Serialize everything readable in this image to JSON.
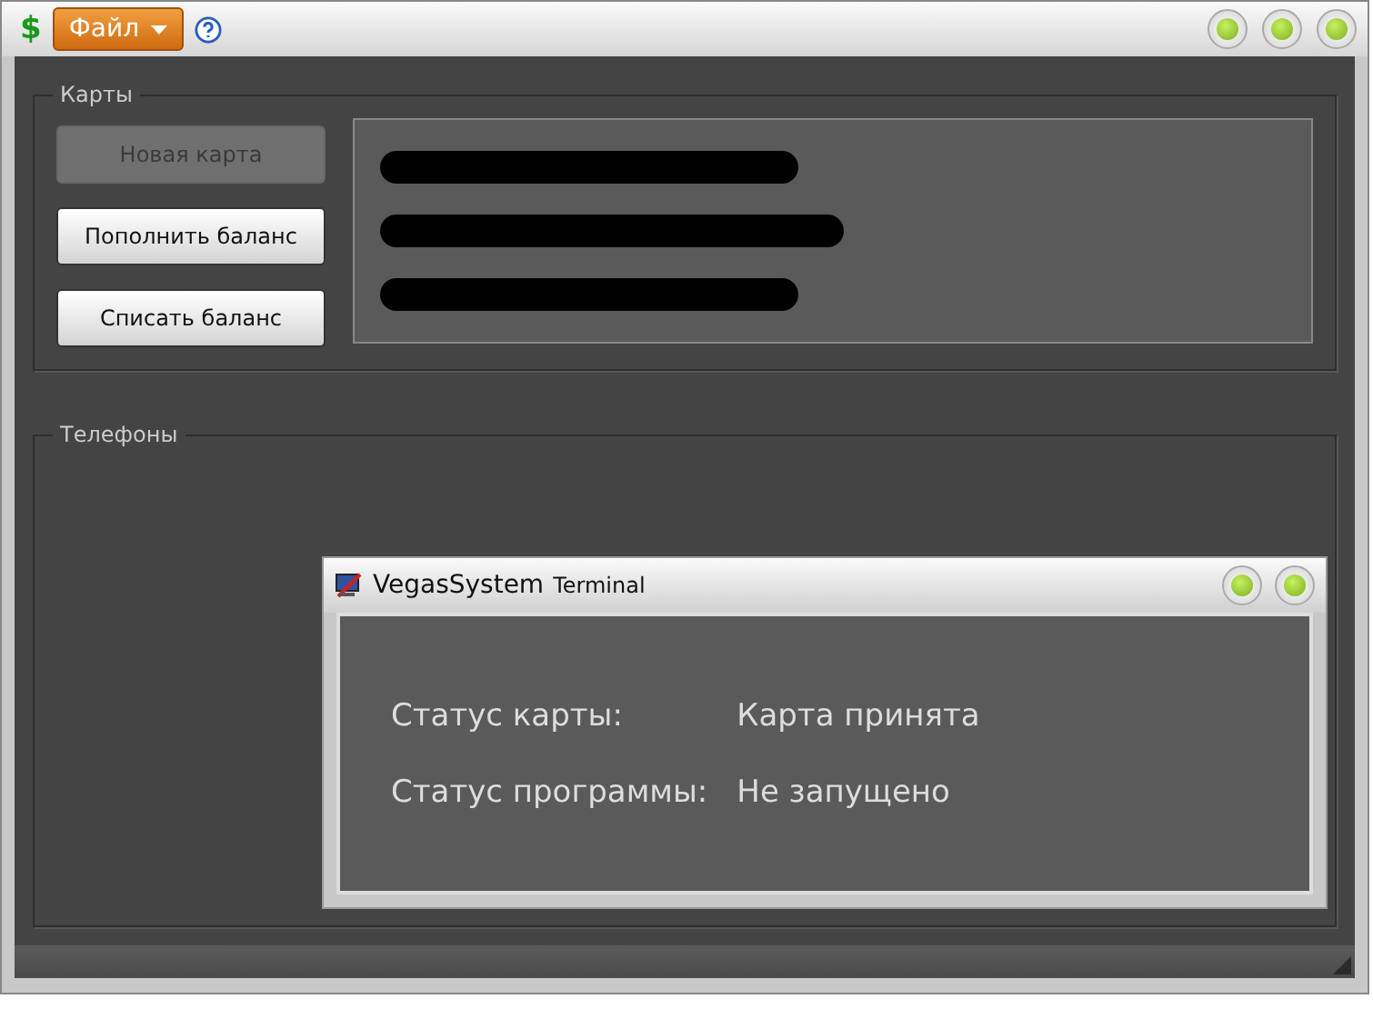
{
  "window": {
    "app_glyph": "$",
    "menu": {
      "label": "Файл"
    },
    "controls": [
      {
        "kind": "circle"
      },
      {
        "kind": "circle"
      },
      {
        "kind": "circle"
      }
    ]
  },
  "cards_group": {
    "title": "Карты",
    "buttons": [
      {
        "label": "Новая карта",
        "disabled": true
      },
      {
        "label": "Пополнить баланс",
        "disabled": false
      },
      {
        "label": "Списать баланс",
        "disabled": false
      }
    ],
    "info_panel": {
      "lines": [
        {
          "kind": "redacted"
        },
        {
          "kind": "redacted"
        },
        {
          "kind": "redacted"
        }
      ]
    }
  },
  "phones_group": {
    "title": "Телефоны"
  },
  "terminal": {
    "title": "VegasSystem",
    "subtitle": "Terminal",
    "controls": [
      {
        "kind": "circle"
      },
      {
        "kind": "circle"
      }
    ],
    "fields": [
      {
        "label": "Статус карты:",
        "value": "Карта принята"
      },
      {
        "label": "Статус программы:",
        "value": "Не запущено"
      }
    ]
  }
}
